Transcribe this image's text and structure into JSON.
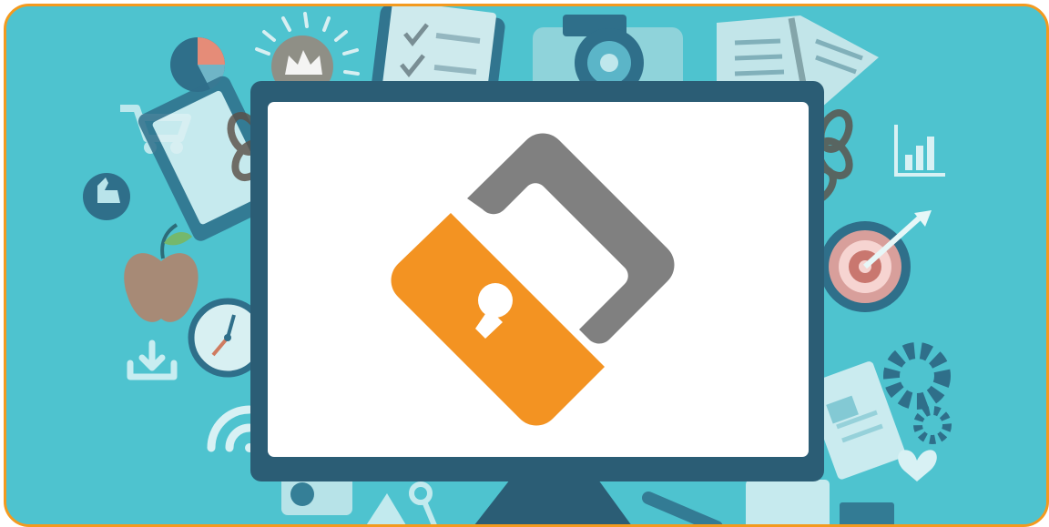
{
  "image": {
    "subject": "computer-monitor-with-padlock-logo",
    "colors": {
      "frame_border": "#f39a1f",
      "background": "#4ec3cf",
      "background_icons": "#a9dde3",
      "monitor_bezel": "#2b5d75",
      "screen": "#ffffff",
      "lock_body": "#f39322",
      "lock_shackle": "#808080"
    },
    "icons": [
      "pie-chart-icon",
      "crown-badge-icon",
      "clipboard-checklist-icon",
      "camera-icon",
      "open-book-icon",
      "shopping-cart-icon",
      "thumbs-up-icon",
      "bar-chart-icon",
      "target-icon",
      "apple-icon",
      "clock-icon",
      "download-icon",
      "wifi-icon",
      "gear-icon",
      "heart-icon",
      "chain-icon",
      "padlock-icon"
    ]
  }
}
